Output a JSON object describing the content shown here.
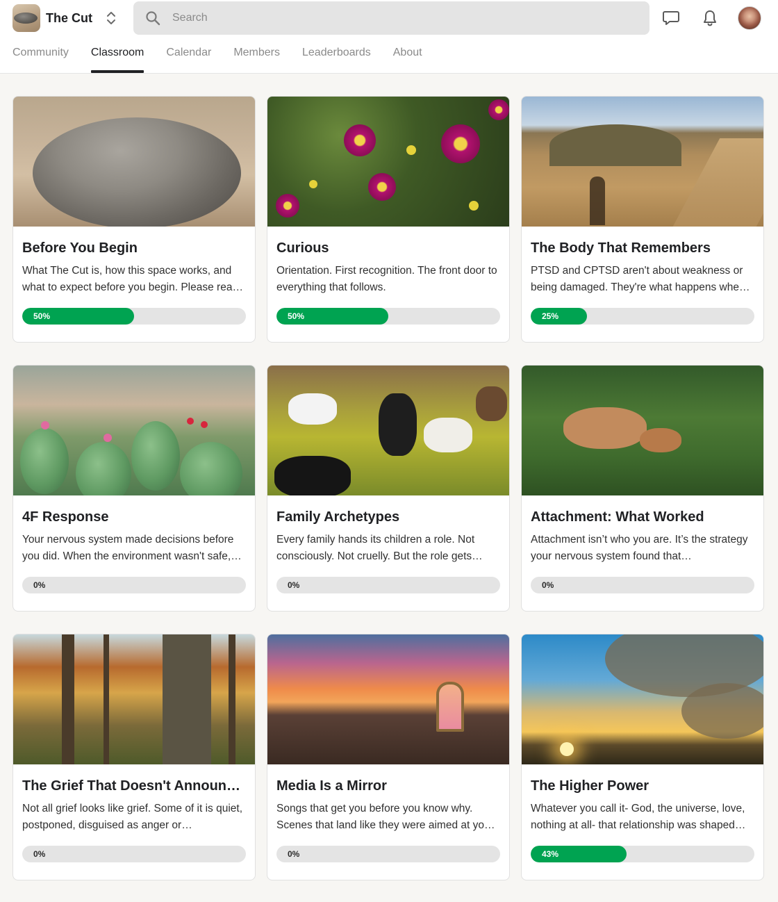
{
  "header": {
    "community_name": "The Cut",
    "search_placeholder": "Search"
  },
  "tabs": [
    {
      "label": "Community"
    },
    {
      "label": "Classroom",
      "active": true
    },
    {
      "label": "Calendar"
    },
    {
      "label": "Members"
    },
    {
      "label": "Leaderboards"
    },
    {
      "label": "About"
    }
  ],
  "colors": {
    "progress_fill": "#00a351",
    "progress_track": "#e4e4e4",
    "active_tab_underline": "#202124"
  },
  "courses": [
    {
      "title": "Before You Begin",
      "description": "What The Cut is, how this space works, and what to expect before you begin. Please rea…",
      "progress_label": "50%",
      "progress": 0.5
    },
    {
      "title": "Curious",
      "description": "Orientation. First recognition. The front door to everything that follows.",
      "progress_label": "50%",
      "progress": 0.5
    },
    {
      "title": "The Body That Remembers",
      "description": "PTSD and CPTSD aren't about weakness or being damaged. They're what happens whe…",
      "progress_label": "25%",
      "progress": 0.25
    },
    {
      "title": "4F Response",
      "description": "Your nervous system made decisions before you did. When the environment wasn't safe,…",
      "progress_label": "0%",
      "progress": 0
    },
    {
      "title": "Family Archetypes",
      "description": "Every family hands its children a role. Not consciously. Not cruelly. But the role gets…",
      "progress_label": "0%",
      "progress": 0
    },
    {
      "title": "Attachment: What Worked",
      "description": "Attachment isn’t who you are. It’s the strategy your nervous system found that…",
      "progress_label": "0%",
      "progress": 0
    },
    {
      "title": "The Grief That Doesn't Announce I…",
      "description": "Not all grief looks like grief. Some of it is quiet, postponed, disguised as anger or…",
      "progress_label": "0%",
      "progress": 0
    },
    {
      "title": "Media Is a Mirror",
      "description": "Songs that get you before you know why. Scenes that land like they were aimed at yo…",
      "progress_label": "0%",
      "progress": 0
    },
    {
      "title": "The Higher Power",
      "description": "Whatever you call it- God, the universe, love, nothing at all- that relationship was shaped…",
      "progress_label": "43%",
      "progress": 0.43
    }
  ]
}
